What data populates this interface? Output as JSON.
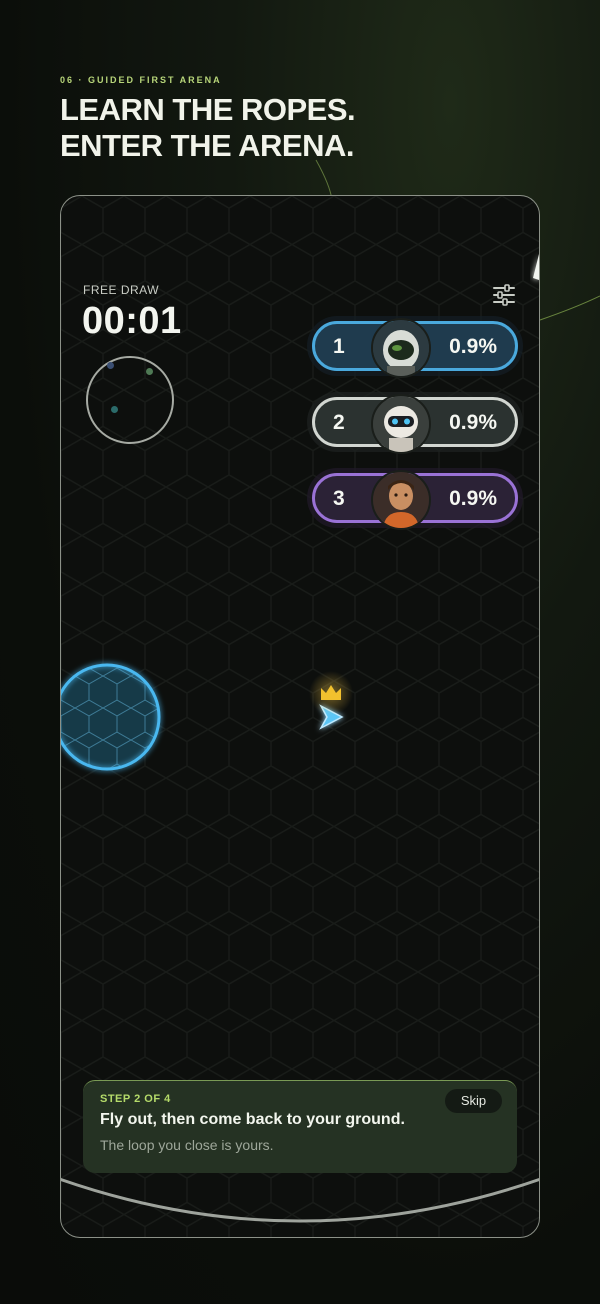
{
  "header": {
    "eyebrow": "06 · GUIDED FIRST ARENA",
    "headline_line1": "LEARN THE ROPES.",
    "headline_line2": "ENTER THE ARENA."
  },
  "hud": {
    "mode_label": "FREE DRAW",
    "timer": "00:01"
  },
  "leaderboard": [
    {
      "rank": "1",
      "percent": "0.9%",
      "avatar": "astronaut-helmet-avatar",
      "color": "#4aa9dd"
    },
    {
      "rank": "2",
      "percent": "0.9%",
      "avatar": "robot-avatar",
      "color": "#d2d6d1"
    },
    {
      "rank": "3",
      "percent": "0.9%",
      "avatar": "pilot-avatar",
      "color": "#9a72d6"
    }
  ],
  "player": {
    "territory_color": "#4ab8f0",
    "marker_icon": "crown-icon",
    "marker_color": "#f2c12e"
  },
  "toast": {
    "step": "STEP 2 OF 4",
    "title": "Fly out, then come back to your ground.",
    "subtitle": "The loop you close is yours.",
    "skip_label": "Skip"
  },
  "colors": {
    "accent": "#b5db6a",
    "toast_bg": "#253223"
  }
}
